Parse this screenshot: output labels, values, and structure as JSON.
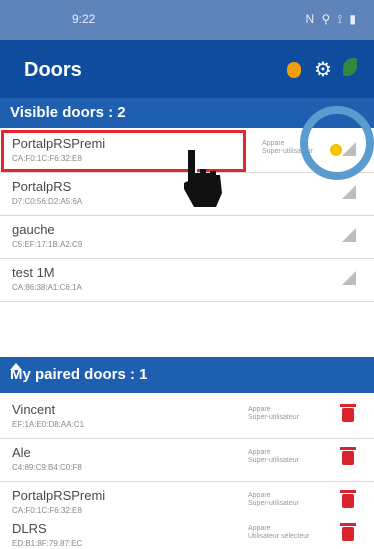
{
  "status": {
    "time": "9:22",
    "indicators": "N ⚲ ⟟ ▮"
  },
  "appbar": {
    "title": "Doors"
  },
  "visible_header": "Visible doors : 2",
  "paired_header": "My paired doors : 1",
  "visible_doors": [
    {
      "name": "PortalpRSPremi",
      "mac": "CA:F0:1C:F6:32:E8",
      "role1": "Appare",
      "role2": "Super-utilisateur"
    },
    {
      "name": "PortalpRS",
      "mac": "D7:C0:56:D2:A5:6A"
    },
    {
      "name": "gauche",
      "mac": "C5:EF:17:1B:A2:C9"
    },
    {
      "name": "test 1M",
      "mac": "CA:86:38:A1:C6:1A"
    }
  ],
  "paired_doors": [
    {
      "name": "Vincent",
      "mac": "EF:1A:E0:D8:AA:C1",
      "role1": "Appare",
      "role2": "Super-utilisateur"
    },
    {
      "name": "Ale",
      "mac": "C4:89:C9:B4:C0:F8",
      "role1": "Appare",
      "role2": "Super-utilisateur"
    },
    {
      "name": "PortalpRSPremi",
      "mac": "CA:F0:1C:F6:32:E8",
      "role1": "Appare",
      "role2": "Super-utilisateur"
    },
    {
      "name": "DLRS",
      "mac": "ED:B1:8F:79:87:EC",
      "role1": "Appare",
      "role2": "Utilisateur sélecteur"
    }
  ],
  "icons": [
    "bluetooth-icon",
    "gear-icon",
    "leaf-icon",
    "signal-icon",
    "trash-icon",
    "collapse-icon",
    "hand-pointer-icon"
  ],
  "colors": {
    "appbar": "#0f4c9e",
    "section": "#1e5fb0",
    "highlight": "#e3262f",
    "accent": "#f2c500"
  }
}
